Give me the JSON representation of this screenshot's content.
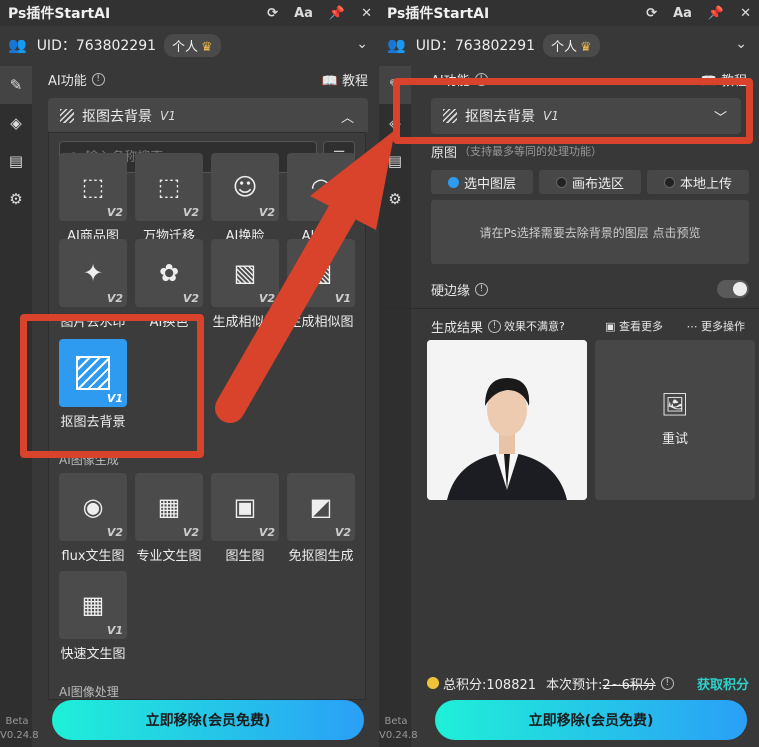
{
  "app": {
    "title": "Ps插件StartAI",
    "controls": [
      "⟳",
      "Aa",
      "📌",
      "✕"
    ]
  },
  "user": {
    "uid_label": "UID：763802291",
    "badge": "个人"
  },
  "sidebar": {
    "beta_label": "Beta",
    "version": "V0.24.8"
  },
  "section": {
    "title": "AI功能",
    "tutorial": "教程"
  },
  "selected_function": {
    "name": "抠图去背景",
    "version": "V1"
  },
  "dropdown": {
    "search_placeholder": "输入名称搜索",
    "row1": [
      {
        "label": "AI商品图",
        "version": "V2",
        "icon": "product-icon"
      },
      {
        "label": "万物迁移",
        "version": "V2",
        "icon": "migrate-icon"
      },
      {
        "label": "AI换脸",
        "version": "V2",
        "icon": "face-swap-icon"
      },
      {
        "label": "AI模特",
        "version": "V2",
        "icon": "model-icon"
      }
    ],
    "row2": [
      {
        "label": "图片去水印",
        "version": "V2",
        "icon": "watermark-icon"
      },
      {
        "label": "AI换色",
        "version": "V2",
        "icon": "palette-icon"
      },
      {
        "label": "生成相似图",
        "version": "V2",
        "icon": "similar-image-icon"
      },
      {
        "label": "生成相似图",
        "version": "V1",
        "icon": "similar-image-icon"
      }
    ],
    "row3": [
      {
        "label": "抠图去背景",
        "version": "V1",
        "icon": "cutout-icon"
      }
    ],
    "group2_label": "AI图像生成",
    "row4": [
      {
        "label": "flux文生图",
        "version": "V2",
        "icon": "flux-icon"
      },
      {
        "label": "专业文生图",
        "version": "V2",
        "icon": "text-image-icon"
      },
      {
        "label": "图生图",
        "version": "V2",
        "icon": "image-to-image-icon"
      },
      {
        "label": "免抠图生成",
        "version": "V2",
        "icon": "no-cutout-icon"
      }
    ],
    "row5": [
      {
        "label": "快速文生图",
        "version": "V1",
        "icon": "fast-text-image-icon"
      }
    ],
    "group3_label": "AI图像处理"
  },
  "right": {
    "source_label": "原图",
    "source_hint": "（支持最多等同的处理功能）",
    "radios": [
      "选中图层",
      "画布选区",
      "本地上传"
    ],
    "preview_text": "请在Ps选择需要去除背景的图层 点击预览",
    "hard_edge_label": "硬边缘",
    "result_label": "生成结果",
    "unsatisfied": "效果不满意?",
    "view_more": "查看更多",
    "more_ops": "更多操作",
    "retry": "重试",
    "points_total": "总积分:108821",
    "points_estimate": "本次预计:",
    "points_range": "2~6积分",
    "get_points": "获取积分"
  },
  "action_button": "立即移除(会员免费)",
  "colors": {
    "accent": "#2e9bf0",
    "annotation": "#d9432b",
    "button_start": "#1ff0d8",
    "button_end": "#2a9ff7"
  }
}
